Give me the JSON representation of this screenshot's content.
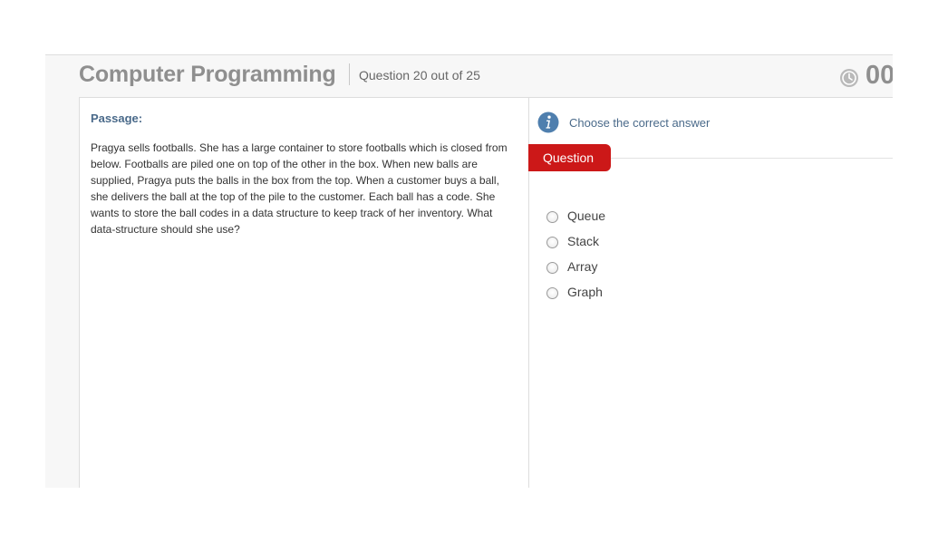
{
  "header": {
    "title": "Computer Programming",
    "question_counter": "Question 20 out of 25",
    "timer": "00"
  },
  "passage": {
    "label": "Passage:",
    "text": "Pragya sells footballs. She has a large container to store footballs which is closed from below. Footballs are piled one on top of the other in the box. When new balls are supplied, Pragya puts the balls in the box from the top. When a customer buys a ball, she delivers the ball at the top of the pile to the customer. Each ball has a code. She wants to store the ball codes in a data structure to keep track of her inventory. What data-structure should she use?"
  },
  "question": {
    "instruction": "Choose the correct answer",
    "tab_label": "Question",
    "options": [
      {
        "label": "Queue"
      },
      {
        "label": "Stack"
      },
      {
        "label": "Array"
      },
      {
        "label": "Graph"
      }
    ]
  },
  "colors": {
    "accent_red": "#cc1818",
    "info_blue": "#4a6a8a",
    "title_gray": "#8f8f8f"
  },
  "icons": {
    "timer": "clock-icon",
    "instruction": "info-icon"
  }
}
